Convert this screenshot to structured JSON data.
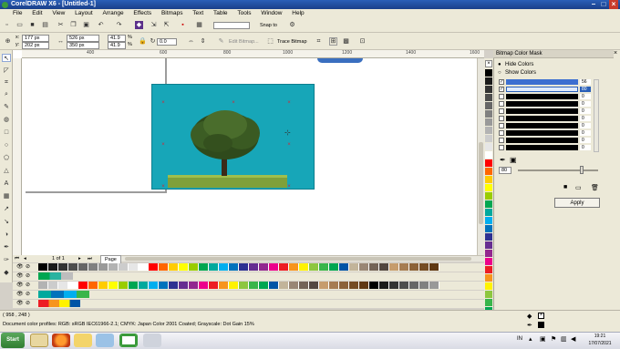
{
  "window": {
    "title": "CorelDRAW X6 - [Untitled-1]"
  },
  "menu": {
    "items": [
      "File",
      "Edit",
      "View",
      "Layout",
      "Arrange",
      "Effects",
      "Bitmaps",
      "Text",
      "Table",
      "Tools",
      "Window",
      "Help"
    ]
  },
  "toolbar": {
    "snap_to": "Snap to",
    "zoom_value": ""
  },
  "property_bar": {
    "x": "177 px",
    "y": "202 px",
    "w": "526 px",
    "h": "350 px",
    "scale_x": "41.9",
    "scale_y": "41.9",
    "scale_unit": "%",
    "rotation": "0.0",
    "edit_bitmap": "Edit Bitmap...",
    "trace_bitmap": "Trace Bitmap"
  },
  "ruler": {
    "ticks": [
      "400",
      "600",
      "800",
      "1000",
      "1200",
      "1400",
      "1600"
    ]
  },
  "page_nav": {
    "count": "1 of 1",
    "tab": "Page 1"
  },
  "docker": {
    "title": "Bitmap Color Mask",
    "mode_hide": "Hide Colors",
    "mode_show": "Show Colors",
    "rows": [
      {
        "checked": true,
        "color": "#3c6fd0",
        "tolerance": "56"
      },
      {
        "checked": true,
        "color": "#e0ecff",
        "tolerance": "80"
      },
      {
        "checked": false,
        "color": "#000000",
        "tolerance": "0"
      },
      {
        "checked": false,
        "color": "#000000",
        "tolerance": "0"
      },
      {
        "checked": false,
        "color": "#000000",
        "tolerance": "0"
      },
      {
        "checked": false,
        "color": "#000000",
        "tolerance": "0"
      },
      {
        "checked": false,
        "color": "#000000",
        "tolerance": "0"
      },
      {
        "checked": false,
        "color": "#000000",
        "tolerance": "0"
      },
      {
        "checked": false,
        "color": "#000000",
        "tolerance": "0"
      },
      {
        "checked": false,
        "color": "#000000",
        "tolerance": "0"
      }
    ],
    "tolerance_value": "80",
    "apply_label": "Apply"
  },
  "status": {
    "coords": "( 958 , 248 )",
    "profile_text": "Document color profiles: RGB: sRGB IEC61966-2.1; CMYK: Japan Color 2001 Coated; Grayscale: Dot Gain 15%"
  },
  "taskbar": {
    "start": "Start",
    "lang": "IN",
    "time": "19:21",
    "date": "17/07/2021"
  },
  "palette_colors": [
    "#000000",
    "#1a1a1a",
    "#333333",
    "#4d4d4d",
    "#666666",
    "#808080",
    "#999999",
    "#b3b3b3",
    "#cccccc",
    "#e6e6e6",
    "#ffffff",
    "#ff0000",
    "#ff6600",
    "#ffcc00",
    "#ffff00",
    "#99cc00",
    "#00a651",
    "#00a99d",
    "#00aeef",
    "#0072bc",
    "#2e3192",
    "#662d91",
    "#92278f",
    "#ec008c",
    "#ed1c24",
    "#f7941d",
    "#fff200",
    "#8dc63f",
    "#39b54a",
    "#00a651",
    "#0054a6",
    "#c2b49a",
    "#998675",
    "#736357",
    "#534741",
    "#c69c6d",
    "#a67c52",
    "#8c6239",
    "#754c24",
    "#603813"
  ],
  "accent": {
    "canvas_bg": "#17a6b8",
    "title_blue": "#1a3f8a"
  }
}
